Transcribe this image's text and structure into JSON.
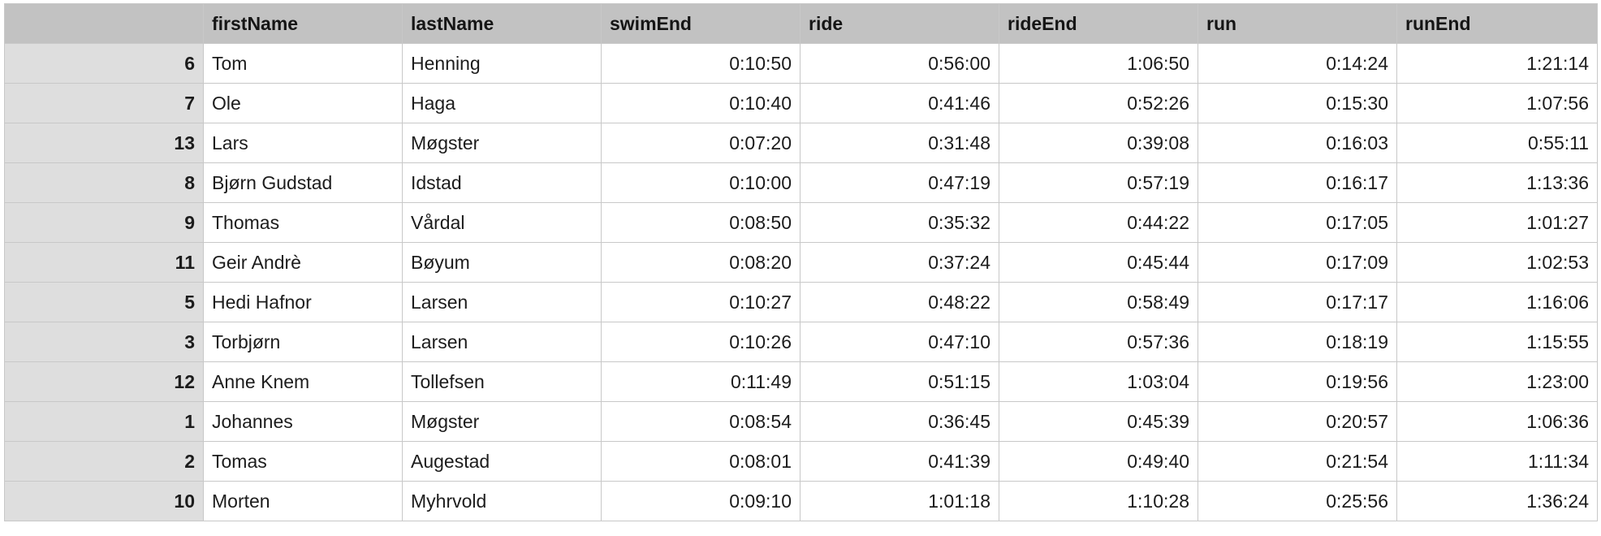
{
  "table": {
    "corner_label": "",
    "columns": [
      "firstName",
      "lastName",
      "swimEnd",
      "ride",
      "rideEnd",
      "run",
      "runEnd"
    ],
    "rows": [
      {
        "id": "6",
        "firstName": "Tom",
        "lastName": "Henning",
        "swimEnd": "0:10:50",
        "ride": "0:56:00",
        "rideEnd": "1:06:50",
        "run": "0:14:24",
        "runEnd": "1:21:14"
      },
      {
        "id": "7",
        "firstName": "Ole",
        "lastName": "Haga",
        "swimEnd": "0:10:40",
        "ride": "0:41:46",
        "rideEnd": "0:52:26",
        "run": "0:15:30",
        "runEnd": "1:07:56"
      },
      {
        "id": "13",
        "firstName": "Lars",
        "lastName": "Møgster",
        "swimEnd": "0:07:20",
        "ride": "0:31:48",
        "rideEnd": "0:39:08",
        "run": "0:16:03",
        "runEnd": "0:55:11"
      },
      {
        "id": "8",
        "firstName": "Bjørn Gudstad",
        "lastName": "Idstad",
        "swimEnd": "0:10:00",
        "ride": "0:47:19",
        "rideEnd": "0:57:19",
        "run": "0:16:17",
        "runEnd": "1:13:36"
      },
      {
        "id": "9",
        "firstName": "Thomas",
        "lastName": "Vårdal",
        "swimEnd": "0:08:50",
        "ride": "0:35:32",
        "rideEnd": "0:44:22",
        "run": "0:17:05",
        "runEnd": "1:01:27"
      },
      {
        "id": "11",
        "firstName": "Geir Andrè",
        "lastName": "Bøyum",
        "swimEnd": "0:08:20",
        "ride": "0:37:24",
        "rideEnd": "0:45:44",
        "run": "0:17:09",
        "runEnd": "1:02:53"
      },
      {
        "id": "5",
        "firstName": "Hedi Hafnor",
        "lastName": "Larsen",
        "swimEnd": "0:10:27",
        "ride": "0:48:22",
        "rideEnd": "0:58:49",
        "run": "0:17:17",
        "runEnd": "1:16:06"
      },
      {
        "id": "3",
        "firstName": "Torbjørn",
        "lastName": "Larsen",
        "swimEnd": "0:10:26",
        "ride": "0:47:10",
        "rideEnd": "0:57:36",
        "run": "0:18:19",
        "runEnd": "1:15:55"
      },
      {
        "id": "12",
        "firstName": "Anne Knem",
        "lastName": "Tollefsen",
        "swimEnd": "0:11:49",
        "ride": "0:51:15",
        "rideEnd": "1:03:04",
        "run": "0:19:56",
        "runEnd": "1:23:00"
      },
      {
        "id": "1",
        "firstName": "Johannes",
        "lastName": "Møgster",
        "swimEnd": "0:08:54",
        "ride": "0:36:45",
        "rideEnd": "0:45:39",
        "run": "0:20:57",
        "runEnd": "1:06:36"
      },
      {
        "id": "2",
        "firstName": "Tomas",
        "lastName": "Augestad",
        "swimEnd": "0:08:01",
        "ride": "0:41:39",
        "rideEnd": "0:49:40",
        "run": "0:21:54",
        "runEnd": "1:11:34"
      },
      {
        "id": "10",
        "firstName": "Morten",
        "lastName": "Myhrvold",
        "swimEnd": "0:09:10",
        "ride": "1:01:18",
        "rideEnd": "1:10:28",
        "run": "0:25:56",
        "runEnd": "1:36:24"
      }
    ]
  }
}
